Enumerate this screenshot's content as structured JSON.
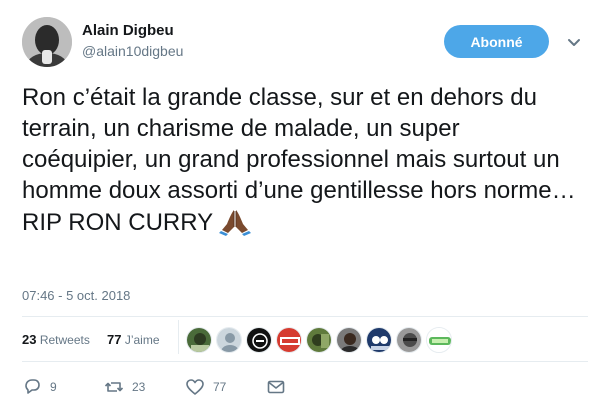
{
  "author": {
    "name": "Alain Digbeu",
    "handle": "@alain10digbeu"
  },
  "follow_button": {
    "label": "Abonné",
    "color": "#4da7e8"
  },
  "menu_icon": "chevron-down-icon",
  "tweet": {
    "text": "Ron c’était la grande classe, sur et en dehors du terrain, un charisme de malade, un super coéquipier, un grand professionnel mais surtout un homme doux assorti d’une gentillesse hors norme…\nRIP RON CURRY",
    "emoji": "folded-hands",
    "timestamp": "07:46 - 5 oct. 2018"
  },
  "stats": {
    "retweets_count": "23",
    "retweets_label": "Retweets",
    "likes_count": "77",
    "likes_label": "J’aime"
  },
  "likers_count_shown": 9,
  "actions": {
    "reply_count": "9",
    "retweet_count": "23",
    "like_count": "77",
    "reply_icon": "reply-icon",
    "retweet_icon": "retweet-icon",
    "like_icon": "heart-icon",
    "dm_icon": "envelope-icon"
  },
  "colors": {
    "text_primary": "#14171a",
    "text_secondary": "#657786",
    "divider": "#e6ecf0"
  }
}
